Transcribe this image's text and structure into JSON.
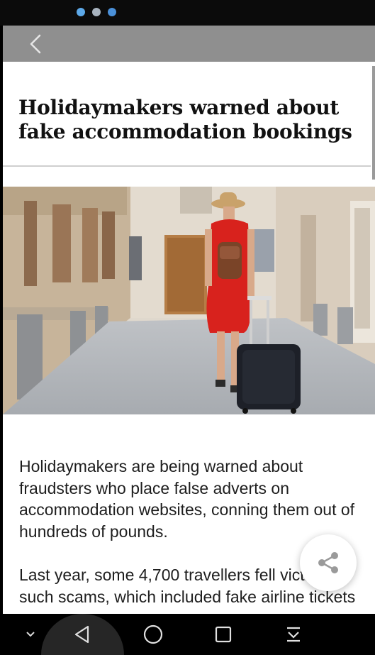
{
  "status_bar": {
    "left_text": "",
    "icons": [
      "circle-blue-icon",
      "circle-gray-icon",
      "circle-badge-icon"
    ],
    "right_text": ""
  },
  "app_bar": {
    "back_icon": "chevron-left-icon"
  },
  "article": {
    "title": "Holidaymakers warned about fake accommodation bookings",
    "image_description": "hero-photo",
    "paragraphs": [
      "Holidaymakers are being warned about fraudsters who place false adverts on accommodation websites, conning them out of hundreds of pounds.",
      "Last year, some 4,700 travellers fell victim to such scams, which included fake airline tickets"
    ]
  },
  "share_button": {
    "icon": "share-icon"
  },
  "nav_bar": {
    "items": [
      "chevron-down-icon",
      "back-triangle-icon",
      "home-circle-icon",
      "recents-square-icon",
      "notifications-pull-icon"
    ]
  },
  "colors": {
    "app_bar": "#8f8f8f",
    "status_bar": "#0b0b0b",
    "dress_red": "#d8221d"
  }
}
